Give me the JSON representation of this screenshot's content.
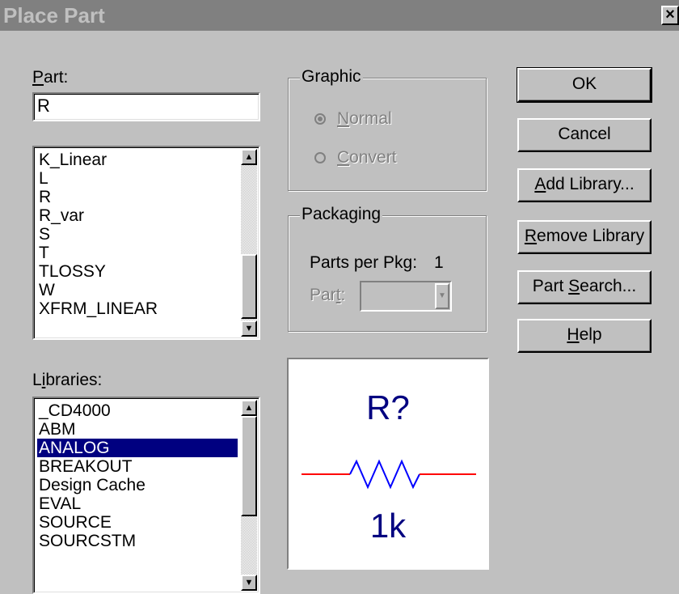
{
  "window": {
    "title": "Place Part",
    "close_glyph": "×"
  },
  "part": {
    "label_prefix": "",
    "label_accel": "P",
    "label_rest": "art:",
    "value": "R"
  },
  "part_list": {
    "items": [
      "K_Linear",
      "L",
      "R",
      "R_var",
      "S",
      "T",
      "TLOSSY",
      "W",
      "XFRM_LINEAR"
    ]
  },
  "libraries": {
    "label_prefix": "L",
    "label_accel": "i",
    "label_rest": "braries:",
    "items": [
      "_CD4000",
      "ABM",
      "ANALOG",
      "BREAKOUT",
      "Design Cache",
      "EVAL",
      "SOURCE",
      "SOURCSTM"
    ],
    "selected": "ANALOG"
  },
  "graphic": {
    "legend": "Graphic",
    "normal": {
      "accel": "N",
      "rest": "ormal",
      "checked": true
    },
    "convert": {
      "accel": "C",
      "rest": "onvert",
      "checked": false
    }
  },
  "packaging": {
    "legend": "Packaging",
    "parts_per_pkg_label": "Parts per Pkg:",
    "parts_per_pkg_value": "1",
    "part_label_prefix": "Par",
    "part_label_accel": "t",
    "part_label_rest": ":"
  },
  "buttons": {
    "ok": "OK",
    "cancel": "Cancel",
    "add_library": {
      "accel": "A",
      "rest": "dd Library..."
    },
    "remove_library": {
      "accel": "R",
      "rest": "emove Library"
    },
    "part_search": {
      "prefix": "Part ",
      "accel": "S",
      "rest": "earch..."
    },
    "help": {
      "accel": "H",
      "rest": "elp"
    }
  },
  "preview": {
    "refdes": "R?",
    "value": "1k",
    "wire_color": "#ff0000",
    "symbol_color": "#0000ff",
    "text_color": "#000080"
  }
}
